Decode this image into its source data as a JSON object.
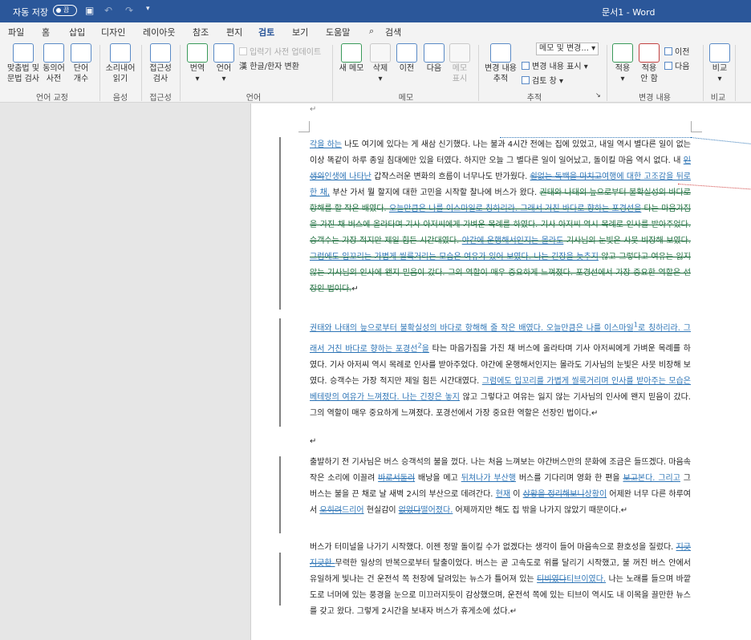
{
  "titlebar": {
    "autosave_label": "자동 저장",
    "toggle_label": "끔",
    "doc_title": "문서1 - Word"
  },
  "tabs": [
    "파일",
    "홈",
    "삽입",
    "디자인",
    "레이아웃",
    "참조",
    "편지",
    "검토",
    "보기",
    "도움말",
    "검색"
  ],
  "ribbon": {
    "spell": "맞춤법 및\n문법 검사",
    "thesaurus": "동의어\n사전",
    "wordcount": "단어\n개수",
    "readaloud": "소리내어\n읽기",
    "accessibility": "접근성\n검사",
    "translate": "번역",
    "language": "언어",
    "input_dict": "입력기 사전 업데이트",
    "hanja": "한글/한자 변환",
    "new_comment": "새 메모",
    "delete": "삭제",
    "prev": "이전",
    "next": "다음",
    "show_comments": "메모\n표시",
    "track_changes": "변경 내용\n추적",
    "markup_dropdown": "메모 및 변경...",
    "show_markup": "변경 내용 표시",
    "review_pane": "검토 창",
    "accept": "적용",
    "reject": "적용\n안 함",
    "prev2": "이전",
    "next2": "다음",
    "compare": "비교",
    "groups": {
      "proofing": "언어 교정",
      "speech": "음성",
      "access": "접근성",
      "lang": "언어",
      "comments": "메모",
      "tracking": "추적",
      "changes": "변경 내용",
      "compare": "비교"
    }
  },
  "document": {
    "pilcrow": "↵",
    "p1_html": "<span class='ins'>각을 하는</span> 나도 여기에 있다는 게 새삼 신기했다. 나는 불과 4시간 전에는 집에 있었고, 내일 역시 별다른 일이 없는 이상 똑같이 하루 종일 침대에만 있을 터였다. 하지만 오늘 그 별다른 일이 일어났고, 돌이킬 마음 역시 없다. 내 <span class='ins'><span class='del'>인생의</span>인생에 나타난</span> 갑작스러운 변화의 흐름이 너무나도 반가웠다. <span class='ins'><span class='del'>쉴없는 독백을 마치고</span>여행에 대한 고조감을 뒤로 한 채,</span> 부산 가서 뭘 할지에 대한 고민을 시작할 찰나에 버스가 왔다. <span class='green'>권태와 나태의 늪으로부터 불확실성의 바다로 항해를 할 작은 배였다. <span class='ins'>오늘만큼은 나를 이스마일로 칭하리라. 그래서 거친 바다로 향하는 포경선을</span> 타는 마음가짐을 가진 채 버스에 올라타며 기사 아저씨에게 가벼운 목례를 하였다. 기사 아저씨 역시 목례로 인사를 받아주었다. 승객수는 가장 적지만 제일 힘든 시간대였다. <span class='ins'>야간에 운행해서인지는 몰라도</span> 기사님의 눈빛은 사뭇 비장해 보였다. <span class='ins'>그럼에도 입꼬리는 가볍게 씰룩거리는 모습은 여유가 있어 보였다. 나는 긴장을 늦추지</span> 않고 그렇다고 여유는 잃지 않는 기사님의 인사에 왠지 믿음이 갔다. 그의 역할이 매우 중요하게 느껴졌다. 포경선에서 가장 중요한 역할은 선장인 법이다.</span>↵",
    "p2_html": "<span class='ins'>권태와 나태의 늪으로부터 불확실성의 바다로 항해해 줄 작은 배였다. 오늘만큼은 나를 이스마일<sup>1</sup>로 칭하리라. 그래서 거친 바다로 향하는 포경선<sup>2</sup>을</span> 타는 마음가짐을 가진 채 버스에 올라타며 기사 아저씨에게 가벼운 목례를 하였다. 기사 아저씨 역시 목례로 인사를 받아주었다. 야간에 운행해서인지는 몰라도 기사님의 눈빛은 사뭇 비장해 보였다. 승객수는 가장 적지만 제일 힘든 시간대였다. <span class='ins'>그럼에도 입꼬리를 가볍게 씰룩거리며 인사를 받아주는 모습은 베테랑의 여유가 느껴졌다. 나는 긴장은 놓지</span> 않고 그렇다고 여유는 잃지 않는 기사님의 인사에 왠지 믿음이 갔다. 그의 역할이 매우 중요하게 느껴졌다. 포경선에서 가장 중요한 역할은 선장인 법이다.↵",
    "p3_html": "↵",
    "p4_html": "출발하기 전 기사님은 버스 승객석의 불을 껐다. 나는 처음 느껴보는 야간버스만의 문화에 조금은 들뜨겠다. 마음속 작은 소리에 이끌려 <span class='ins'><span class='del'>바로서둘러</span></span> 배낭을 메고 <span class='ins'>뒤쳐나가 부산행</span> 버스를 기다리며 영화 한 편을 <span class='ins'><span class='del'>보고</span>본다. 그리고</span> 그 버스는 불을 끈 채로 날 새벽 2시의 부산으로 데려간다. <span class='ins'>현재</span> 이 <span class='ins'><span class='del'>상황을 정리해보니</span>상황이</span> 어제완 너무 다른 하루여서 <span class='ins'><span class='del'>오히려</span>드리어</span> 현실감이 <span class='ins'><span class='del'>없었다</span>떨어졌다.</span> 어제까지만 해도 집 밖을 나가지 않았기 때문이다.↵",
    "p5_html": " 버스가 터미널을 나가기 시작했다. 이젠 정말 돌이킬 수가 없겠다는 생각이 들어 마음속으로 환호성을 질렀다. <span class='ins'><span class='del'>지긋지긋한 </span></span>무력한 일상의 반복으로부터 탈출이었다. 버스는 곧 고속도로 위를 달리기 시작했고, 불 꺼진 버스 안에서 유일하게 빛나는 건 운전석 쪽 천장에 달려있는 뉴스가 틀어져 있는 <span class='ins'><span class='del'>티비였다</span>티브이였다.</span> 나는 노래를 들으며 바깥 도로 너머에 있는 풍경을 눈으로 미끄러지듯이 감상했으며, 운전석 쪽에 있는 티브이 역시도 내 이목을 끌만한 뉴스를 갖고 왔다. 그렇게 2시간을 보내자 버스가 휴게소에 섰다.↵"
  }
}
